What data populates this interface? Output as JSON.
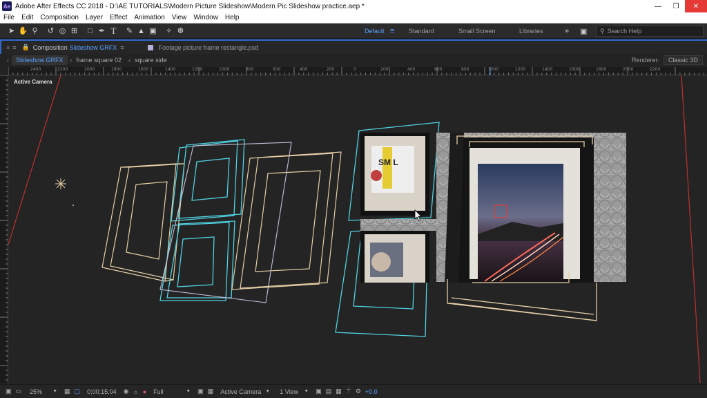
{
  "window": {
    "title": "Adobe After Effects CC 2018 - D:\\AE TUTORIALS\\Modern Picture Slideshow\\Modern Pic Slideshow practice.aep *",
    "app_icon": "Ae"
  },
  "menu": [
    "File",
    "Edit",
    "Composition",
    "Layer",
    "Effect",
    "Animation",
    "View",
    "Window",
    "Help"
  ],
  "workspaces": {
    "default": "Default",
    "standard": "Standard",
    "small_screen": "Small Screen",
    "libraries": "Libraries",
    "search_placeholder": "Search Help"
  },
  "panel": {
    "comp_tab_prefix": "Composition",
    "comp_tab_name": "Slideshow GRFX",
    "footage_tab": "Footage  picture frame rectangle.psd",
    "breadcrumbs": [
      "Slideshow GRFX",
      "frame square 02",
      "square side"
    ],
    "renderer_label": "Renderer:",
    "renderer_value": "Classic 3D"
  },
  "ruler_labels": [
    "2400",
    "2200",
    "2000",
    "1800",
    "1600",
    "1400",
    "1200",
    "1000",
    "800",
    "600",
    "400",
    "200",
    "0",
    "200",
    "400",
    "600",
    "800",
    "1000",
    "1200",
    "1400",
    "1600",
    "1800",
    "2000",
    "2200"
  ],
  "viewport": {
    "camera_label": "Active Camera"
  },
  "bottom": {
    "zoom": "25%",
    "timecode": "0;00;15;04",
    "resolution": "Full",
    "view": "Active Camera",
    "views": "1 View",
    "exposure": "+0.0"
  },
  "colors": {
    "accent": "#5aa0ff",
    "frame_beige": "#e6cfa6",
    "frame_cyan": "#4fd3e3",
    "frame_lavender": "#c9c0dc",
    "camera_line": "#c03030"
  }
}
